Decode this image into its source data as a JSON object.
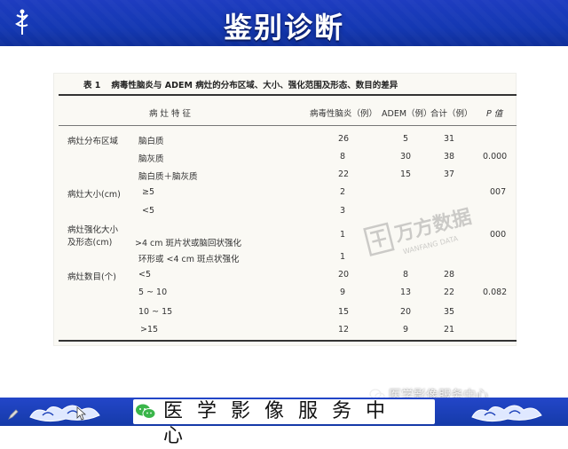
{
  "header": {
    "title": "鉴别诊断"
  },
  "table": {
    "caption_label": "表 1",
    "caption_text": "病毒性脑炎与 ADEM 病灶的分布区域、大小、强化范围及形态、数目的差异",
    "headers": {
      "feature": "病 灶 特 征",
      "viral": "病毒性脑炎（例）",
      "adem": "ADEM（例）",
      "total": "合计（例）",
      "p": "P 值"
    },
    "groups": [
      {
        "label": "病灶分布区域",
        "p": "0.000"
      },
      {
        "label": "病灶大小(cm)",
        "p": "007"
      },
      {
        "label": "病灶强化大小",
        "label2": "及形态(cm)",
        "p": "000"
      },
      {
        "label": "病灶数目(个)",
        "p": "0.082"
      }
    ],
    "rows": [
      {
        "sub": "脑白质",
        "viral": "26",
        "adem": "5",
        "total": "31"
      },
      {
        "sub": "脑灰质",
        "viral": "8",
        "adem": "30",
        "total": "38"
      },
      {
        "sub": "脑白质＋脑灰质",
        "viral": "22",
        "adem": "15",
        "total": "37"
      },
      {
        "sub": "≥5",
        "viral": "2",
        "adem": "",
        "total": ""
      },
      {
        "sub": "<5",
        "viral": "3",
        "adem": "",
        "total": ""
      },
      {
        "sub": ">4 cm 斑片状或脑回状强化",
        "viral": "1",
        "adem": "",
        "total": ""
      },
      {
        "sub": "环形或 <4 cm 斑点状强化",
        "viral": "1",
        "adem": "",
        "total": ""
      },
      {
        "sub": "<5",
        "viral": "20",
        "adem": "8",
        "total": "28"
      },
      {
        "sub": "5 ~ 10",
        "viral": "9",
        "adem": "13",
        "total": "22"
      },
      {
        "sub": "10 ~ 15",
        "viral": "15",
        "adem": "20",
        "total": "35"
      },
      {
        "sub": ">15",
        "viral": "12",
        "adem": "9",
        "total": "21"
      }
    ]
  },
  "watermark": {
    "text": "万方数据",
    "subtext": "WANFANG DATA"
  },
  "footer": {
    "text": "医学影像服务中心"
  },
  "account": {
    "text": "医学影像服务中心"
  },
  "colors": {
    "header_blue": "#1438b3",
    "footer_blue": "#153aa8",
    "text": "#333333"
  }
}
